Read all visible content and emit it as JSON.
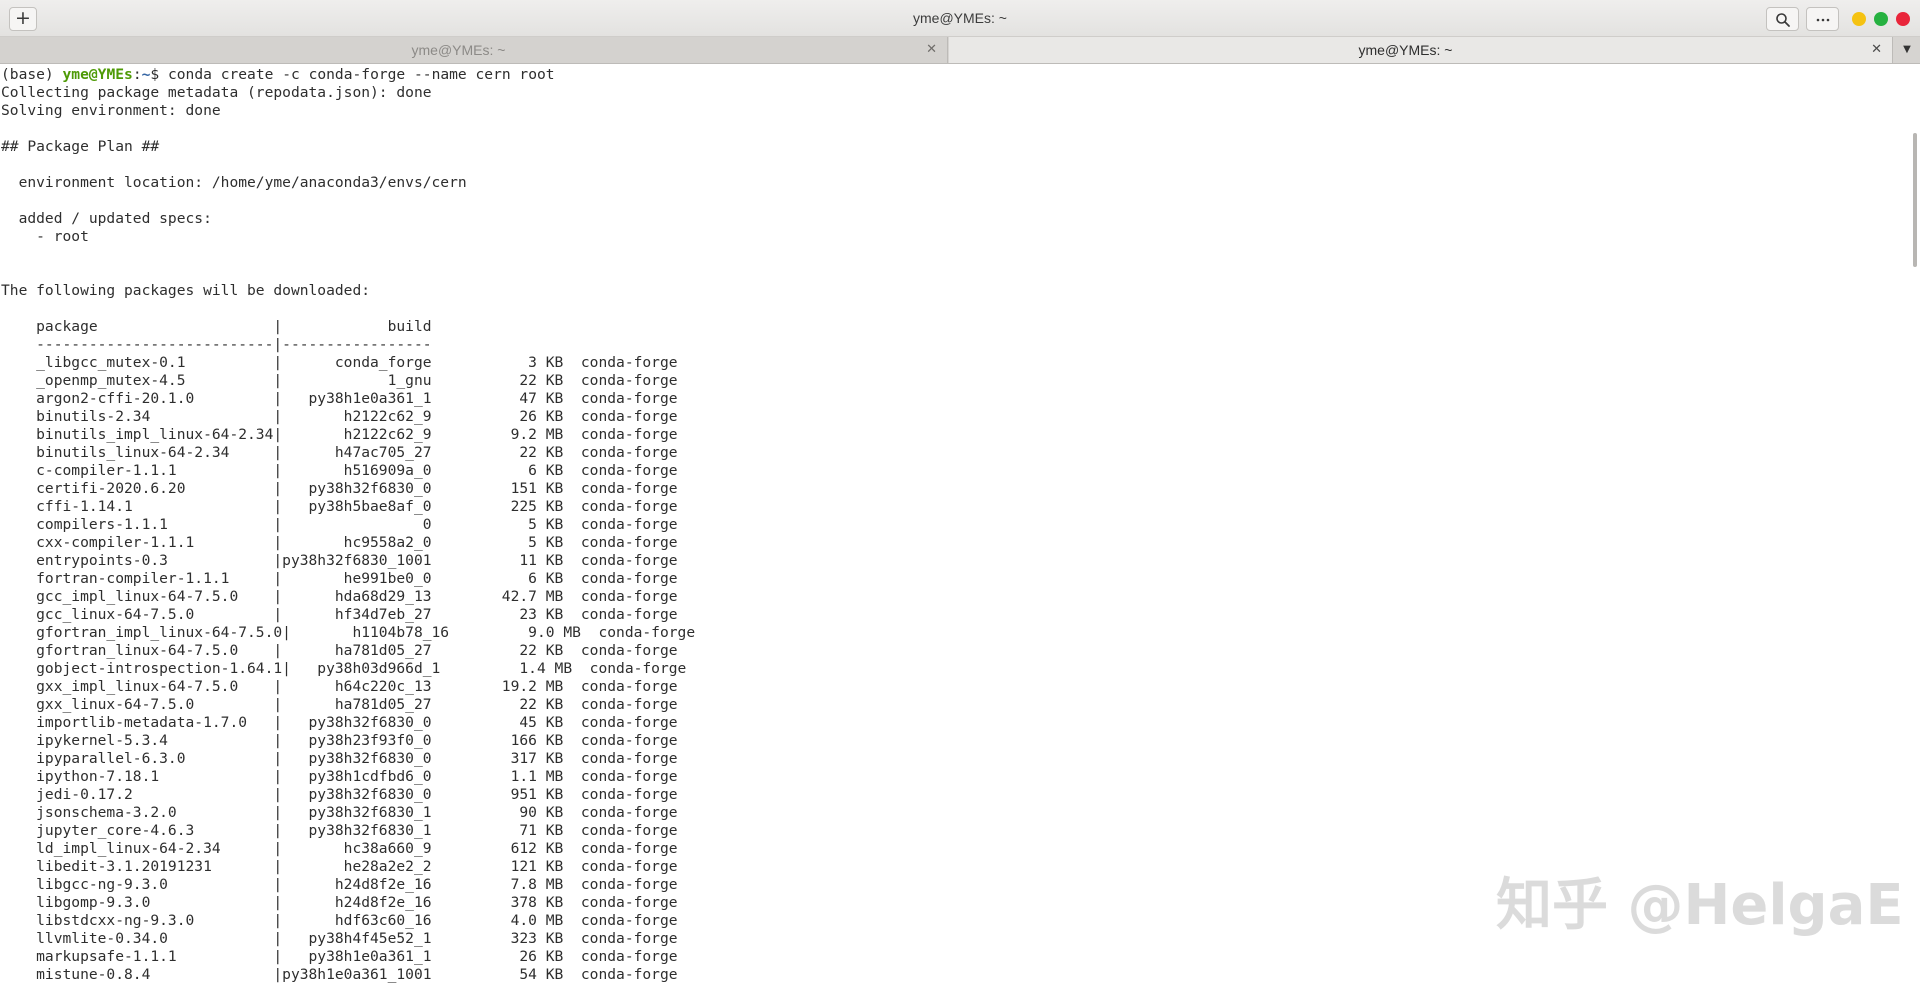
{
  "window": {
    "title": "yme@YMEs: ~",
    "new_tab_glyph": "+",
    "icons": {
      "new_tab": "plus-icon",
      "search": "search-icon",
      "menu": "more-horizontal-icon",
      "minimize": "minimize-dot-icon",
      "maximize": "maximize-dot-icon",
      "close": "close-dot-icon"
    },
    "button_colors": {
      "minimize": "#f5c211",
      "maximize": "#26b140",
      "close": "#e9253a"
    }
  },
  "tabs": [
    {
      "label": "yme@YMEs: ~",
      "active": false,
      "close_glyph": "✕"
    },
    {
      "label": "yme@YMEs: ~",
      "active": true,
      "close_glyph": "✕"
    }
  ],
  "tabs_dropdown_glyph": "▼",
  "prompt": {
    "env": "(base) ",
    "user": "yme@YMEs",
    "sep": ":",
    "path": "~",
    "symbol": "$ ",
    "command": "conda create -c conda-forge --name cern root",
    "colors": {
      "user": "#4e9a06",
      "path": "#3465a4"
    }
  },
  "terminal": {
    "lines": [
      "Collecting package metadata (repodata.json): done",
      "Solving environment: done",
      "",
      "## Package Plan ##",
      "",
      "  environment location: /home/yme/anaconda3/envs/cern",
      "",
      "  added / updated specs:",
      "    - root",
      "",
      "",
      "The following packages will be downloaded:",
      "",
      "    package                    |            build",
      "    ---------------------------|-----------------",
      "    _libgcc_mutex-0.1          |      conda_forge           3 KB  conda-forge",
      "    _openmp_mutex-4.5          |            1_gnu          22 KB  conda-forge",
      "    argon2-cffi-20.1.0         |   py38h1e0a361_1          47 KB  conda-forge",
      "    binutils-2.34              |       h2122c62_9          26 KB  conda-forge",
      "    binutils_impl_linux-64-2.34|       h2122c62_9         9.2 MB  conda-forge",
      "    binutils_linux-64-2.34     |      h47ac705_27          22 KB  conda-forge",
      "    c-compiler-1.1.1           |       h516909a_0           6 KB  conda-forge",
      "    certifi-2020.6.20          |   py38h32f6830_0         151 KB  conda-forge",
      "    cffi-1.14.1                |   py38h5bae8af_0         225 KB  conda-forge",
      "    compilers-1.1.1            |                0           5 KB  conda-forge",
      "    cxx-compiler-1.1.1         |       hc9558a2_0           5 KB  conda-forge",
      "    entrypoints-0.3            |py38h32f6830_1001          11 KB  conda-forge",
      "    fortran-compiler-1.1.1     |       he991be0_0           6 KB  conda-forge",
      "    gcc_impl_linux-64-7.5.0    |      hda68d29_13        42.7 MB  conda-forge",
      "    gcc_linux-64-7.5.0         |      hf34d7eb_27          23 KB  conda-forge",
      "    gfortran_impl_linux-64-7.5.0|       h1104b78_16         9.0 MB  conda-forge",
      "    gfortran_linux-64-7.5.0    |      ha781d05_27          22 KB  conda-forge",
      "    gobject-introspection-1.64.1|   py38h03d966d_1         1.4 MB  conda-forge",
      "    gxx_impl_linux-64-7.5.0    |      h64c220c_13        19.2 MB  conda-forge",
      "    gxx_linux-64-7.5.0         |      ha781d05_27          22 KB  conda-forge",
      "    importlib-metadata-1.7.0   |   py38h32f6830_0          45 KB  conda-forge",
      "    ipykernel-5.3.4            |   py38h23f93f0_0         166 KB  conda-forge",
      "    ipyparallel-6.3.0          |   py38h32f6830_0         317 KB  conda-forge",
      "    ipython-7.18.1             |   py38h1cdfbd6_0         1.1 MB  conda-forge",
      "    jedi-0.17.2                |   py38h32f6830_0         951 KB  conda-forge",
      "    jsonschema-3.2.0           |   py38h32f6830_1          90 KB  conda-forge",
      "    jupyter_core-4.6.3         |   py38h32f6830_1          71 KB  conda-forge",
      "    ld_impl_linux-64-2.34      |       hc38a660_9         612 KB  conda-forge",
      "    libedit-3.1.20191231       |       he28a2e2_2         121 KB  conda-forge",
      "    libgcc-ng-9.3.0            |      h24d8f2e_16         7.8 MB  conda-forge",
      "    libgomp-9.3.0              |      h24d8f2e_16         378 KB  conda-forge",
      "    libstdcxx-ng-9.3.0         |      hdf63c60_16         4.0 MB  conda-forge",
      "    llvmlite-0.34.0            |   py38h4f45e52_1         323 KB  conda-forge",
      "    markupsafe-1.1.1           |   py38h1e0a361_1          26 KB  conda-forge",
      "    mistune-0.8.4              |py38h1e0a361_1001          54 KB  conda-forge"
    ]
  },
  "watermark": "知乎 @HelgaE"
}
